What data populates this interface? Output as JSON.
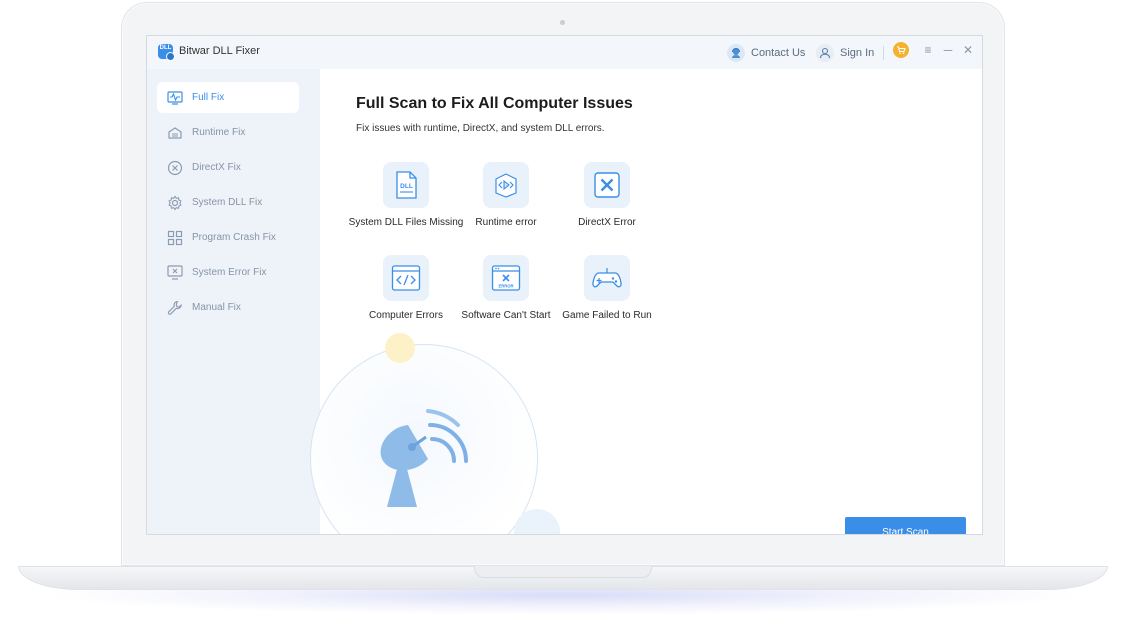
{
  "window": {
    "title": "Bitwar DLL Fixer",
    "logo_text": "DLL"
  },
  "titlebar": {
    "contact_label": "Contact Us",
    "signin_label": "Sign In",
    "min_glyph": "─",
    "close_glyph": "✕",
    "menu_glyph": "≡"
  },
  "sidebar": {
    "items": [
      {
        "label": "Full Fix",
        "icon": "pulse-monitor-icon",
        "active": true
      },
      {
        "label": "Runtime Fix",
        "icon": "runtime-icon"
      },
      {
        "label": "DirectX Fix",
        "icon": "x-circle-icon"
      },
      {
        "label": "System DLL Fix",
        "icon": "gear-icon"
      },
      {
        "label": "Program Crash Fix",
        "icon": "grid-icon"
      },
      {
        "label": "System Error Fix",
        "icon": "monitor-x-icon"
      },
      {
        "label": "Manual Fix",
        "icon": "wrench-icon"
      }
    ]
  },
  "main": {
    "title": "Full Scan to Fix All Computer Issues",
    "subtitle": "Fix issues with runtime, DirectX, and system DLL errors.",
    "issues": [
      {
        "label": "System DLL Files Missing",
        "icon": "dll-file-icon"
      },
      {
        "label": "Runtime error",
        "icon": "runtime-error-icon"
      },
      {
        "label": "DirectX Error",
        "icon": "directx-x-icon"
      },
      {
        "label": "Computer Errors",
        "icon": "code-window-icon"
      },
      {
        "label": "Software Can't Start",
        "icon": "error-window-icon"
      },
      {
        "label": "Game Failed to Run",
        "icon": "gamepad-icon"
      }
    ],
    "dll_tag": "DLL",
    "error_tag": "ERROR",
    "start_button": "Start Scan"
  },
  "colors": {
    "accent": "#3a8ee8",
    "sidebar_bg": "#eef3f9",
    "cart": "#f5b22e"
  }
}
